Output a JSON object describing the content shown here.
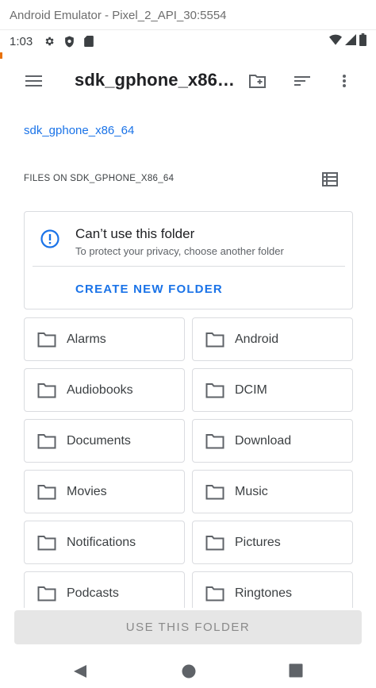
{
  "window": {
    "title": "Android Emulator - Pixel_2_API_30:5554"
  },
  "status_bar": {
    "time": "1:03",
    "left_icons": [
      "gear-icon",
      "shield-icon",
      "sd-card-icon"
    ],
    "right_icons": [
      "wifi-icon",
      "signal-icon",
      "battery-icon"
    ]
  },
  "app_bar": {
    "title": "sdk_gphone_x86…",
    "actions": [
      "menu-icon",
      "new-folder-icon",
      "sort-icon",
      "more-vert-icon"
    ]
  },
  "breadcrumb": "sdk_gphone_x86_64",
  "section_header": "FILES ON SDK_GPHONE_X86_64",
  "warning": {
    "title": "Can’t use this folder",
    "subtitle": "To protect your privacy, choose another folder",
    "action": "CREATE NEW FOLDER"
  },
  "folders": [
    "Alarms",
    "Android",
    "Audiobooks",
    "DCIM",
    "Documents",
    "Download",
    "Movies",
    "Music",
    "Notifications",
    "Pictures",
    "Podcasts",
    "Ringtones"
  ],
  "bottom": {
    "use_folder": "USE THIS FOLDER"
  },
  "colors": {
    "accent": "#1a73e8",
    "text": "#202124",
    "border": "#dadce0",
    "disabled_bg": "#e6e6e6"
  }
}
